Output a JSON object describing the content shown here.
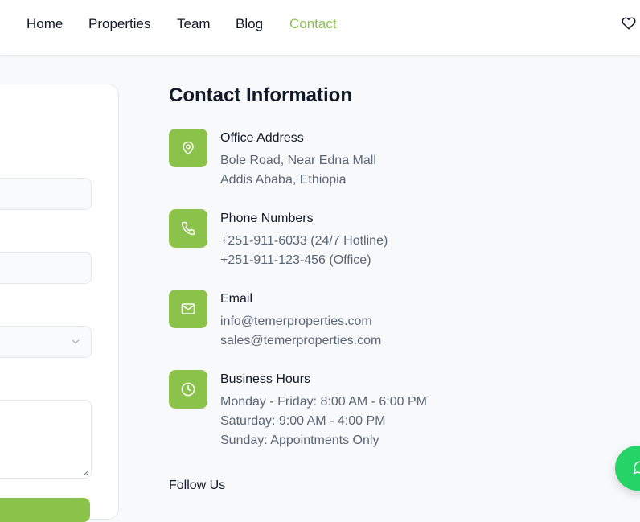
{
  "nav": {
    "items": [
      {
        "label": "Home"
      },
      {
        "label": "Properties"
      },
      {
        "label": "Team"
      },
      {
        "label": "Blog"
      },
      {
        "label": "Contact",
        "active": true
      }
    ],
    "favorites_icon": "heart-icon"
  },
  "colors": {
    "accent": "#8bc34a",
    "text": "#111827",
    "muted": "#5b6577",
    "chat": "#25d366"
  },
  "contact": {
    "title": "Contact Information",
    "items": [
      {
        "title": "Office Address",
        "icon": "map-pin-icon",
        "lines": [
          "Bole Road, Near Edna Mall",
          "Addis Ababa, Ethiopia"
        ]
      },
      {
        "title": "Phone Numbers",
        "icon": "phone-icon",
        "lines": [
          "+251-911-6033 (24/7 Hotline)",
          "+251-911-123-456 (Office)"
        ]
      },
      {
        "title": "Email",
        "icon": "mail-icon",
        "lines": [
          "info@temerproperties.com",
          "sales@temerproperties.com"
        ]
      },
      {
        "title": "Business Hours",
        "icon": "clock-icon",
        "lines": [
          "Monday - Friday: 8:00 AM - 6:00 PM",
          "Saturday: 9:00 AM - 4:00 PM",
          "Sunday: Appointments Only"
        ]
      }
    ],
    "follow_title": "Follow Us"
  },
  "chat": {
    "icon": "chat-icon"
  }
}
